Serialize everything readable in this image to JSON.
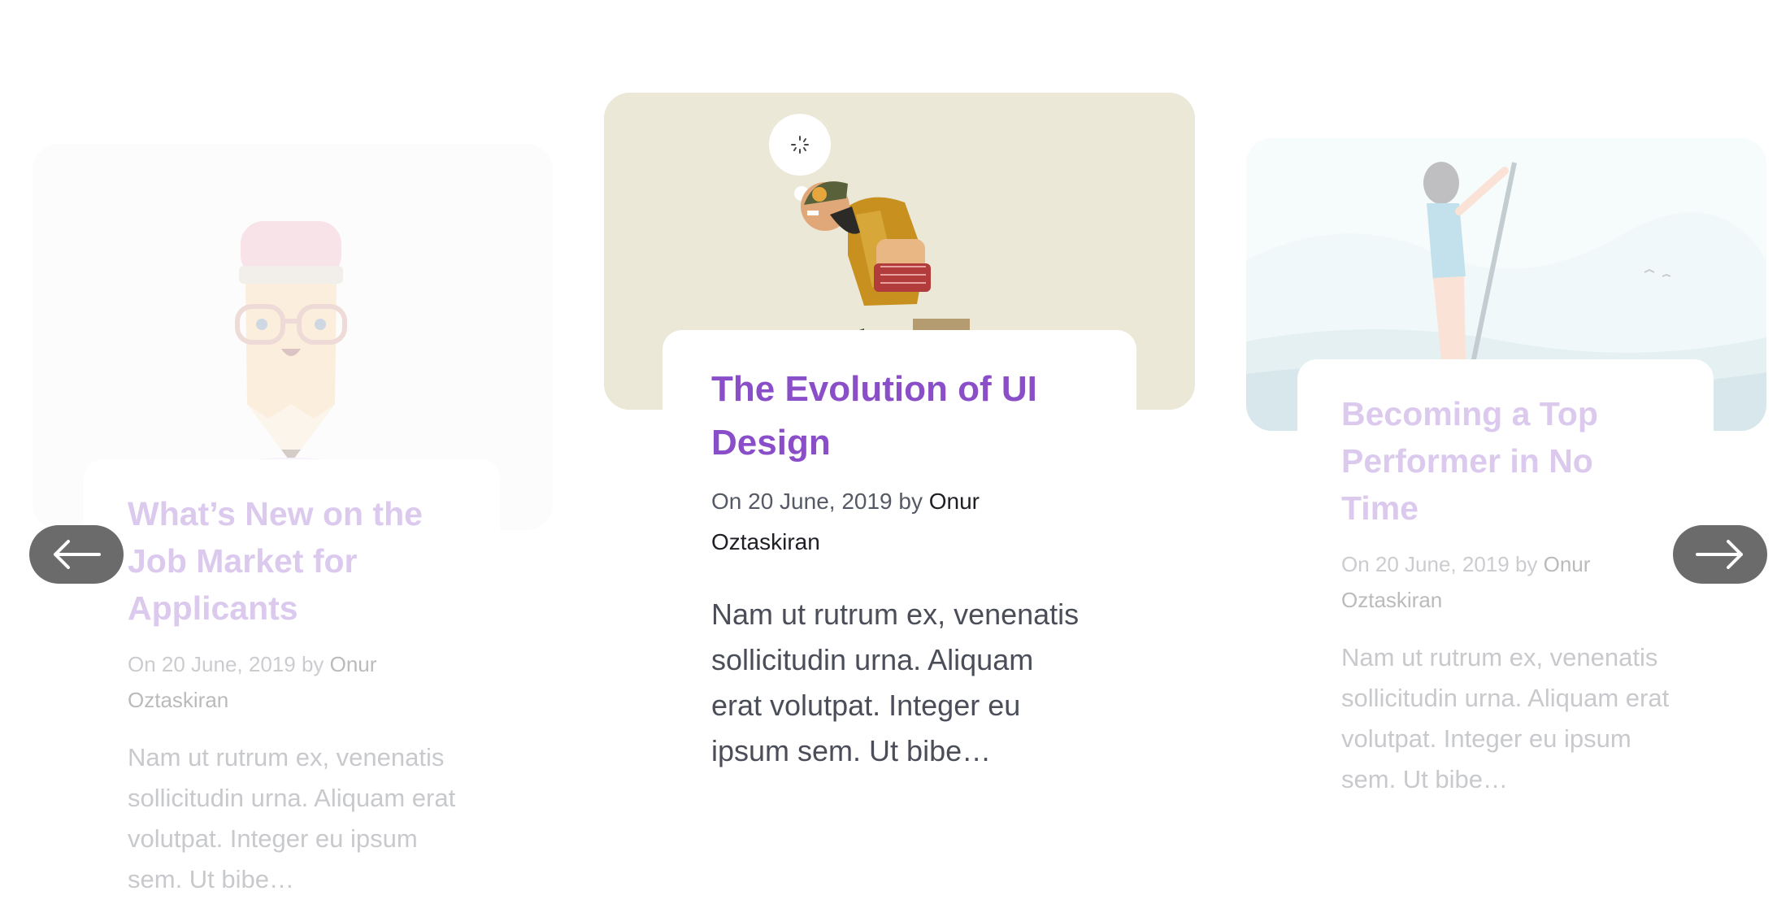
{
  "cards": [
    {
      "title": "What’s New on the Job Market for Applicants",
      "meta_prefix": "On 20 June, 2019 by ",
      "author": "Onur Oztaskiran",
      "excerpt": "Nam ut rutrum ex, venenatis sollicitudin urna. Aliquam erat volutpat. Integer eu ipsum sem. Ut bibe…"
    },
    {
      "title": "The Evolution of UI Design",
      "meta_prefix": "On 20 June, 2019 by ",
      "author": "Onur Oztaskiran",
      "excerpt": "Nam ut rutrum ex, venenatis sollicitudin urna. Aliquam erat volutpat. Integer eu ipsum sem. Ut bibe…"
    },
    {
      "title": "Becoming a Top Performer in No Time",
      "meta_prefix": "On 20 June, 2019 by ",
      "author": "Onur Oztaskiran",
      "excerpt": "Nam ut rutrum ex, venenatis sollicitudin urna. Aliquam erat volutpat. Integer eu ipsum sem. Ut bibe…"
    }
  ],
  "nav": {
    "prev_icon": "arrow-left-icon",
    "next_icon": "arrow-right-icon"
  },
  "colors": {
    "title": "#8a4fc8",
    "nav_button": "#6b6b6b"
  }
}
